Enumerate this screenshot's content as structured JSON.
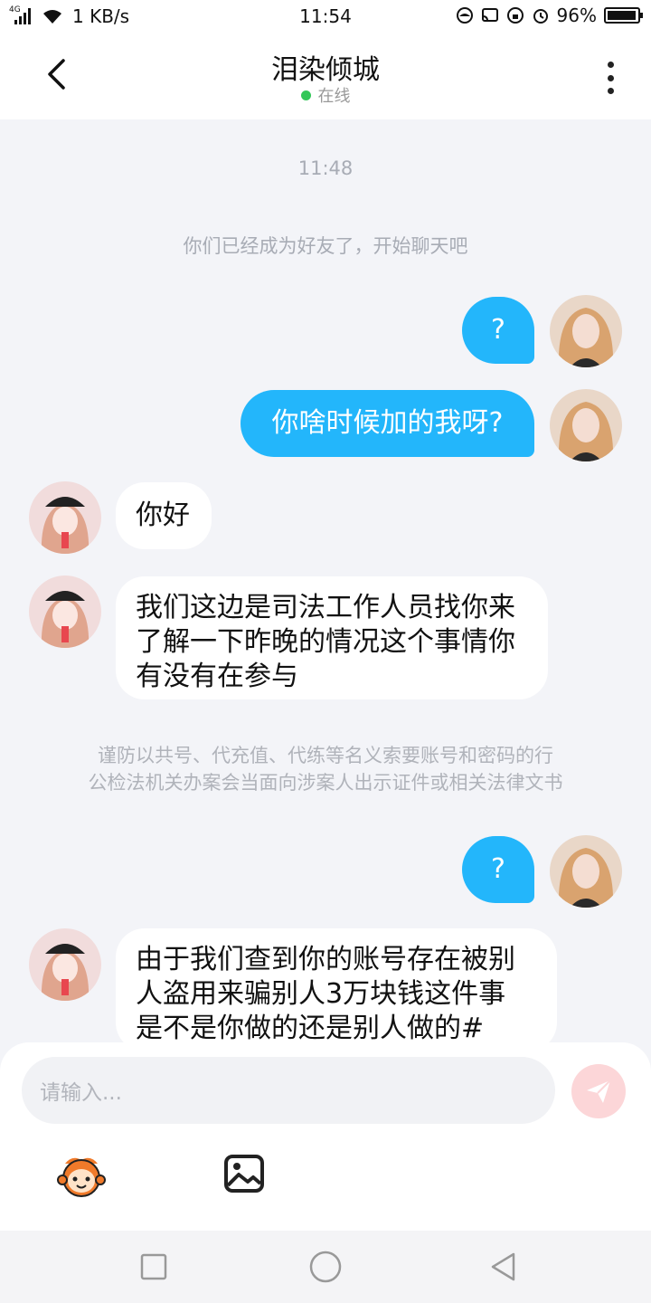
{
  "status_bar": {
    "network": "4G",
    "speed": "1 KB/s",
    "time": "11:54",
    "battery": "96%",
    "battery_level": 0.96
  },
  "header": {
    "title": "泪染倾城",
    "status": "在线",
    "status_color": "#34c759"
  },
  "chat": {
    "timestamp": "11:48",
    "system_notice": "你们已经成为好友了，开始聊天吧",
    "messages": [
      {
        "from": "me",
        "text": "?"
      },
      {
        "from": "me",
        "text": "你啥时候加的我呀?"
      },
      {
        "from": "them",
        "text": "你好"
      },
      {
        "from": "them",
        "lines": [
          "我们这边是司法工作人员找你来",
          "了解一下昨晚的情况这个事情你",
          "有没有在参与"
        ]
      },
      {
        "from": "me",
        "text": "?"
      },
      {
        "from": "them",
        "lines": [
          "由于我们查到你的账号存在被别",
          "人盗用来骗别人3万块钱这件事",
          "是不是你做的还是别人做的#"
        ]
      }
    ],
    "warning_lines": [
      "谨防以共号、代充值、代练等名义索要账号和密码的行",
      "公检法机关办案会当面向涉案人出示证件或相关法律文书"
    ]
  },
  "input": {
    "placeholder": "请输入..."
  },
  "colors": {
    "my_bubble": "#23b6fb",
    "their_bubble": "#ffffff",
    "send_button": "#fcd6d8",
    "background": "#f3f4f8"
  },
  "icons": {
    "back": "chevron-left-icon",
    "more": "more-vertical-icon",
    "send": "send-plane-icon",
    "emoji": "emoji-mascot-icon",
    "image": "image-icon",
    "nav_recent": "square-icon",
    "nav_home": "circle-icon",
    "nav_back": "triangle-back-icon"
  }
}
